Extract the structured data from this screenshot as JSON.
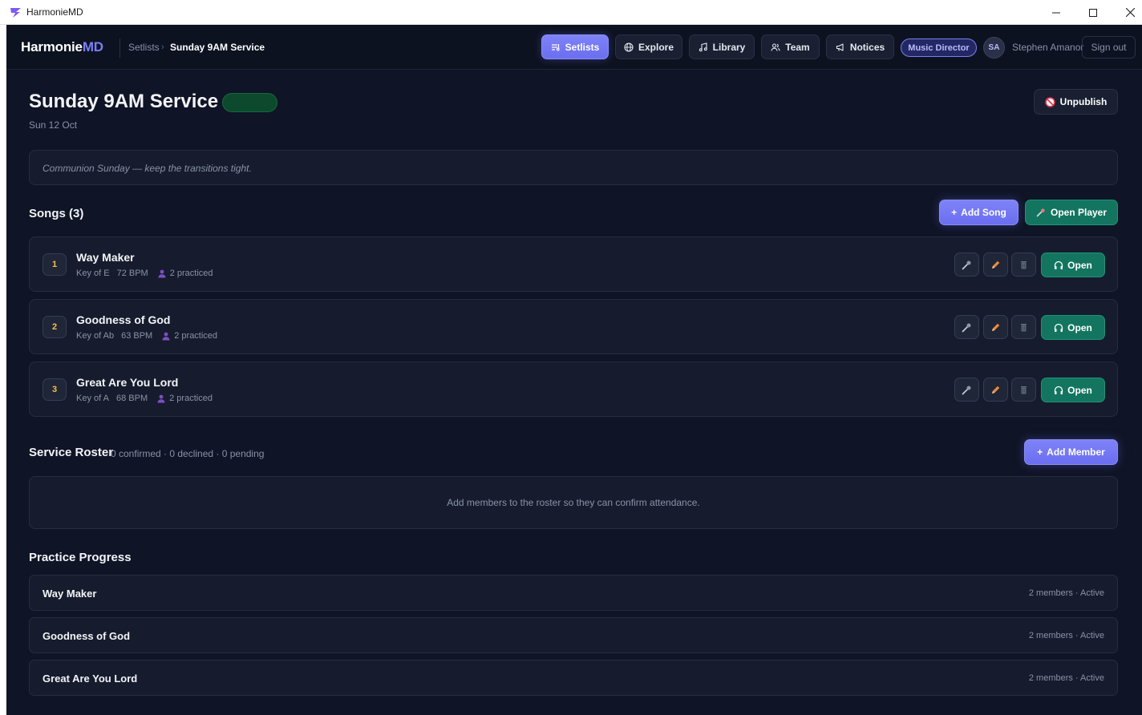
{
  "window": {
    "title": "HarmonieMD"
  },
  "nav": {
    "logo_main": "Harmonie",
    "logo_accent": "MD",
    "breadcrumb": [
      "Setlists",
      "Sunday 9AM Service"
    ],
    "breadcrumb_sep": "›",
    "tabs": [
      {
        "label": "Setlists",
        "icon": "setlist-icon",
        "active": true
      },
      {
        "label": "Explore",
        "icon": "globe-icon",
        "active": false
      },
      {
        "label": "Library",
        "icon": "music-note-icon",
        "active": false
      },
      {
        "label": "Team",
        "icon": "users-icon",
        "active": false
      },
      {
        "label": "Notices",
        "icon": "megaphone-icon",
        "active": false
      }
    ],
    "role": "Music Director",
    "avatar_initials": "SA",
    "user_name": "Stephen Amanor",
    "signout": "Sign out"
  },
  "header": {
    "title": "Sunday 9AM Service",
    "status": "",
    "date": "Sun 12 Oct",
    "unpublish": "Unpublish",
    "note": "Communion Sunday — keep the transitions tight."
  },
  "songs_section": {
    "title": "Songs (3)",
    "add_song": "Add Song",
    "add_prefix": "+",
    "open_player": "Open Player",
    "open_label": "Open",
    "items": [
      {
        "num": "1",
        "title": "Way Maker",
        "key": "Key of E",
        "bpm": "72 BPM",
        "practiced": "2 practiced"
      },
      {
        "num": "2",
        "title": "Goodness of God",
        "key": "Key of Ab",
        "bpm": "63 BPM",
        "practiced": "2 practiced"
      },
      {
        "num": "3",
        "title": "Great Are You Lord",
        "key": "Key of A",
        "bpm": "68 BPM",
        "practiced": "2 practiced"
      }
    ]
  },
  "roster": {
    "title": "Service Roster",
    "summary": "0 confirmed · 0 declined · 0 pending",
    "add_member": "Add Member",
    "empty_text": "Add members to the roster so they can confirm attendance."
  },
  "practice": {
    "title": "Practice Progress",
    "rows": [
      {
        "title": "Way Maker",
        "meta": "2 members · Active"
      },
      {
        "title": "Goodness of God",
        "meta": "2 members · Active"
      },
      {
        "title": "Great Are You Lord",
        "meta": "2 members · Active"
      }
    ]
  },
  "colors": {
    "accent": "#6a6ef0",
    "green": "#13755f",
    "background": "#0f1426",
    "card": "#161c2d"
  }
}
